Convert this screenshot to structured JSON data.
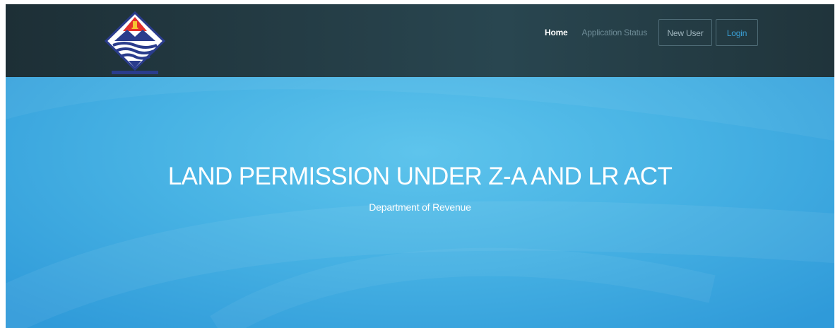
{
  "header": {
    "logo_icon": "uttarakhand-emblem-icon",
    "nav": {
      "home_label": "Home",
      "status_label": "Application Status",
      "new_user_label": "New User",
      "login_label": "Login"
    }
  },
  "hero": {
    "title": "LAND PERMISSION UNDER Z-A AND LR ACT",
    "subtitle": "Department of Revenue"
  },
  "colors": {
    "navbar_bg": "#253e47",
    "hero_bg": "#48b3e4",
    "login_text": "#3aa0d6"
  }
}
